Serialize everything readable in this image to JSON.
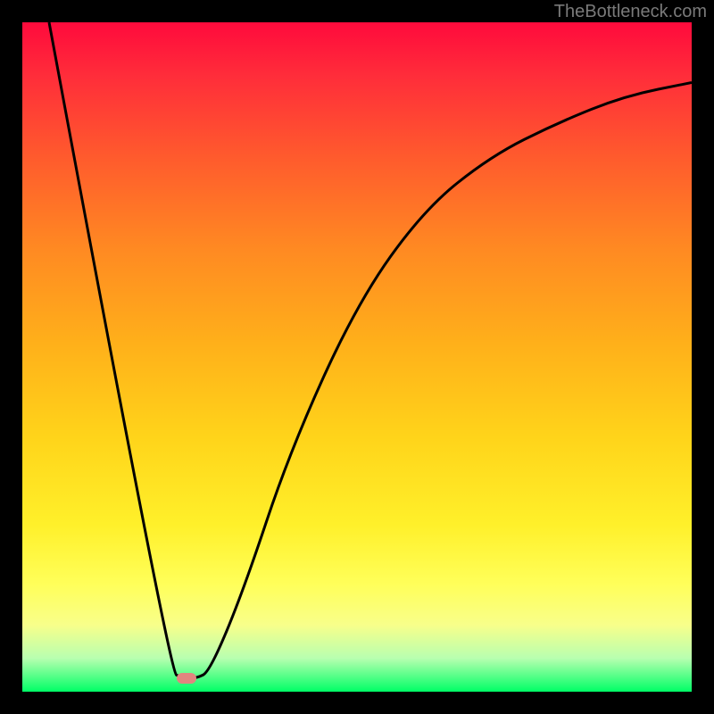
{
  "attribution": "TheBottleneck.com",
  "chart_data": {
    "type": "line",
    "title": "",
    "xlabel": "",
    "ylabel": "",
    "xlim": [
      0,
      100
    ],
    "ylim": [
      0,
      100
    ],
    "series": [
      {
        "name": "curve",
        "points": [
          {
            "x": 4,
            "y": 100
          },
          {
            "x": 22,
            "y": 3
          },
          {
            "x": 24,
            "y": 2
          },
          {
            "x": 26,
            "y": 2
          },
          {
            "x": 28,
            "y": 3
          },
          {
            "x": 33,
            "y": 15
          },
          {
            "x": 40,
            "y": 36
          },
          {
            "x": 50,
            "y": 58
          },
          {
            "x": 60,
            "y": 72
          },
          {
            "x": 70,
            "y": 80
          },
          {
            "x": 80,
            "y": 85
          },
          {
            "x": 90,
            "y": 89
          },
          {
            "x": 100,
            "y": 91
          }
        ]
      }
    ],
    "marker": {
      "x": 24.5,
      "y": 2,
      "color": "#e2857f"
    },
    "gradient_stops": [
      {
        "pos": 0,
        "color": "#ff0a3c"
      },
      {
        "pos": 50,
        "color": "#ffb01a"
      },
      {
        "pos": 80,
        "color": "#ffff5a"
      },
      {
        "pos": 100,
        "color": "#00ff66"
      }
    ]
  }
}
